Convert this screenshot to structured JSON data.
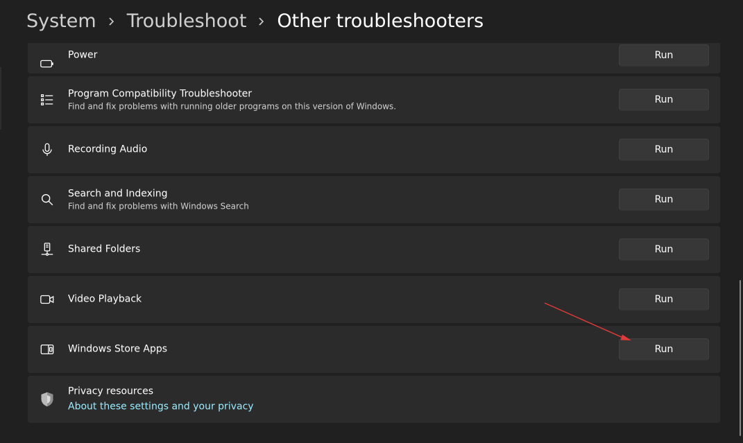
{
  "breadcrumb": {
    "items": [
      "System",
      "Troubleshoot"
    ],
    "current": "Other troubleshooters"
  },
  "troubleshooters": [
    {
      "title": "Power",
      "description": "",
      "icon": "battery-icon",
      "button": "Run"
    },
    {
      "title": "Program Compatibility Troubleshooter",
      "description": "Find and fix problems with running older programs on this version of Windows.",
      "icon": "list-icon",
      "button": "Run"
    },
    {
      "title": "Recording Audio",
      "description": "",
      "icon": "microphone-icon",
      "button": "Run"
    },
    {
      "title": "Search and Indexing",
      "description": "Find and fix problems with Windows Search",
      "icon": "search-icon",
      "button": "Run"
    },
    {
      "title": "Shared Folders",
      "description": "",
      "icon": "network-drive-icon",
      "button": "Run"
    },
    {
      "title": "Video Playback",
      "description": "",
      "icon": "video-camera-icon",
      "button": "Run"
    },
    {
      "title": "Windows Store Apps",
      "description": "",
      "icon": "store-apps-icon",
      "button": "Run"
    }
  ],
  "privacy": {
    "title": "Privacy resources",
    "link": "About these settings and your privacy",
    "icon": "shield-icon"
  },
  "colors": {
    "background": "#202020",
    "card": "#2b2b2b",
    "button": "#373737",
    "link": "#99ebff",
    "annotation_arrow": "#e03a3a"
  }
}
